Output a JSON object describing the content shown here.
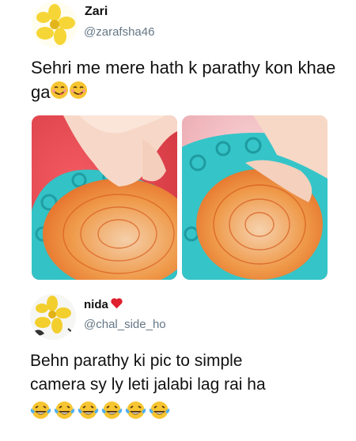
{
  "tweet": {
    "display_name": "Zari",
    "handle": "@zarafsha46",
    "text": "Sehri me mere hath k parathy kon khae ga",
    "emojis": [
      "face-savoring-food-emoji",
      "face-savoring-food-emoji"
    ],
    "photos": [
      "paratha-photo-left",
      "paratha-photo-right"
    ]
  },
  "reply": {
    "display_name": "nida",
    "name_badge": "red-heart-emoji",
    "handle": "@chal_side_ho",
    "text_line1": "Behn parathy ki pic to simple",
    "text_line2": "camera  sy ly leti jalabi lag rai ha",
    "emojis": [
      "laughing-tears-emoji",
      "laughing-tears-emoji",
      "laughing-tears-emoji",
      "laughing-tears-emoji",
      "laughing-tears-emoji",
      "laughing-tears-emoji"
    ]
  }
}
